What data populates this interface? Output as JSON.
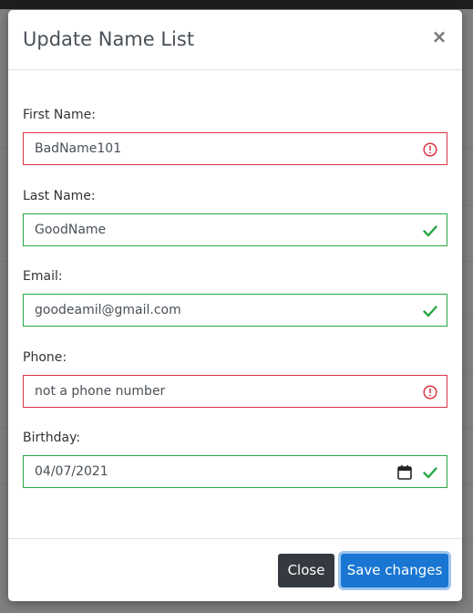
{
  "modal": {
    "title": "Update Name List",
    "close_symbol": "×"
  },
  "fields": [
    {
      "label": "First Name:",
      "value": "BadName101",
      "status": "invalid",
      "icon": "error-icon"
    },
    {
      "label": "Last Name:",
      "value": "GoodName",
      "status": "valid",
      "icon": "check-icon"
    },
    {
      "label": "Email:",
      "value": "goodeamil@gmail.com",
      "status": "valid",
      "icon": "check-icon"
    },
    {
      "label": "Phone:",
      "value": "not a phone number",
      "status": "invalid",
      "icon": "error-icon"
    },
    {
      "label": "Birthday:",
      "value": "04/07/2021",
      "status": "valid",
      "icon": "check-icon",
      "extra_icon": "calendar-icon"
    }
  ],
  "footer": {
    "close_label": "Close",
    "save_label": "Save changes"
  },
  "colors": {
    "valid": "#28a745",
    "invalid": "#dc3545",
    "primary": "#1976d2",
    "dark": "#343a40"
  }
}
